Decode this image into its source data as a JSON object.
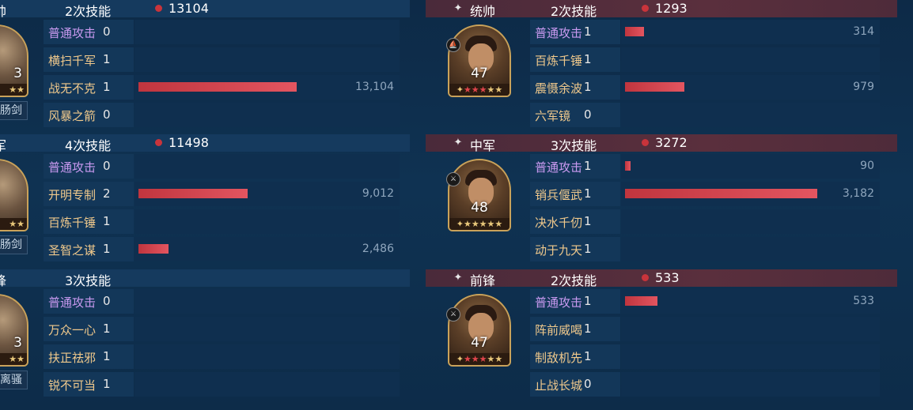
{
  "left": {
    "groups": [
      {
        "role": "帅",
        "casts": "2次技能",
        "damage": "13104",
        "level": "3",
        "weapon": "肠剑",
        "skills": [
          {
            "name": "普通攻击",
            "count": "0",
            "value": "",
            "fraction": 0,
            "is_attack": true
          },
          {
            "name": "横扫千军",
            "count": "1",
            "value": "",
            "fraction": 0,
            "is_attack": false
          },
          {
            "name": "战无不克",
            "count": "1",
            "value": "13,104",
            "fraction": 1.0,
            "is_attack": false
          },
          {
            "name": "风暴之箭",
            "count": "0",
            "value": "",
            "fraction": 0,
            "is_attack": false
          }
        ]
      },
      {
        "role": "军",
        "casts": "4次技能",
        "damage": "11498",
        "level": "",
        "weapon": "肠剑",
        "skills": [
          {
            "name": "普通攻击",
            "count": "0",
            "value": "",
            "fraction": 0,
            "is_attack": true
          },
          {
            "name": "开明专制",
            "count": "2",
            "value": "9,012",
            "fraction": 0.688,
            "is_attack": false
          },
          {
            "name": "百炼千锤",
            "count": "1",
            "value": "",
            "fraction": 0,
            "is_attack": false
          },
          {
            "name": "圣智之谋",
            "count": "1",
            "value": "2,486",
            "fraction": 0.19,
            "is_attack": false
          }
        ]
      },
      {
        "role": "锋",
        "casts": "3次技能",
        "damage": "",
        "level": "3",
        "weapon": "离骚",
        "skills": [
          {
            "name": "普通攻击",
            "count": "0",
            "value": "",
            "fraction": 0,
            "is_attack": true
          },
          {
            "name": "万众一心",
            "count": "1",
            "value": "",
            "fraction": 0,
            "is_attack": false
          },
          {
            "name": "扶正祛邪",
            "count": "1",
            "value": "",
            "fraction": 0,
            "is_attack": false
          },
          {
            "name": "锐不可当",
            "count": "1",
            "value": "",
            "fraction": 0,
            "is_attack": false
          }
        ]
      }
    ]
  },
  "right": {
    "groups": [
      {
        "role": "统帅",
        "casts": "2次技能",
        "damage": "1293",
        "level": "47",
        "skills": [
          {
            "name": "普通攻击",
            "count": "1",
            "value": "314",
            "fraction": 0.024,
            "is_attack": true
          },
          {
            "name": "百炼千锤",
            "count": "1",
            "value": "",
            "fraction": 0,
            "is_attack": false
          },
          {
            "name": "震慑余波",
            "count": "1",
            "value": "979",
            "fraction": 0.075,
            "is_attack": false
          },
          {
            "name": "六军镜",
            "count": "0",
            "value": "",
            "fraction": 0,
            "is_attack": false
          }
        ]
      },
      {
        "role": "中军",
        "casts": "3次技能",
        "damage": "3272",
        "level": "48",
        "skills": [
          {
            "name": "普通攻击",
            "count": "1",
            "value": "90",
            "fraction": 0.007,
            "is_attack": true
          },
          {
            "name": "销兵偃武",
            "count": "1",
            "value": "3,182",
            "fraction": 0.243,
            "is_attack": false
          },
          {
            "name": "决水千仞",
            "count": "1",
            "value": "",
            "fraction": 0,
            "is_attack": false
          },
          {
            "name": "动于九天",
            "count": "1",
            "value": "",
            "fraction": 0,
            "is_attack": false
          }
        ]
      },
      {
        "role": "前锋",
        "casts": "2次技能",
        "damage": "533",
        "level": "47",
        "skills": [
          {
            "name": "普通攻击",
            "count": "1",
            "value": "533",
            "fraction": 0.041,
            "is_attack": true
          },
          {
            "name": "阵前威喝",
            "count": "1",
            "value": "",
            "fraction": 0,
            "is_attack": false
          },
          {
            "name": "制敌机先",
            "count": "1",
            "value": "",
            "fraction": 0,
            "is_attack": false
          },
          {
            "name": "止战长城",
            "count": "0",
            "value": "",
            "fraction": 0,
            "is_attack": false
          }
        ]
      }
    ]
  },
  "colors": {
    "bar": "#d8434d",
    "attack_name": "#c99af0",
    "skill_name": "#f0c98c",
    "header_red": "#5a2f3d"
  },
  "icons": {
    "header_marker": "sparkle-icon",
    "dot": "damage-dot-icon",
    "stars": "star-icon"
  }
}
